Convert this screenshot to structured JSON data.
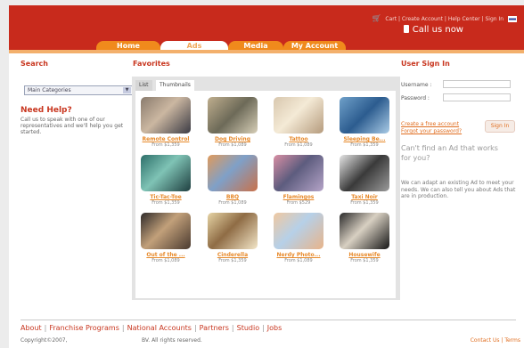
{
  "header": {
    "links": [
      "Cart",
      "Create Account",
      "Help Center",
      "Sign In"
    ],
    "call_us": "Call us now",
    "colors": {
      "header": "#c82a1c",
      "tab": "#f08a1c",
      "accent": "#e06d1f"
    }
  },
  "tabs": [
    {
      "label": "Home"
    },
    {
      "label": "Ads"
    },
    {
      "label": "Media"
    },
    {
      "label": "My Account"
    }
  ],
  "search": {
    "title": "Search",
    "select_value": "Main Categories",
    "help_title": "Need Help?",
    "help_text": "Call us to speak with one of our representatives and we'll help you get started."
  },
  "favorites": {
    "title": "Favorites",
    "view_tabs": [
      "List",
      "Thumbnails"
    ],
    "items": [
      {
        "title": "Remote Control",
        "price": "From $1,359",
        "icon": "businessman-photo"
      },
      {
        "title": "Dog Driving",
        "price": "From $1,089",
        "icon": "dog-photo"
      },
      {
        "title": "Tattoo",
        "price": "From $1,089",
        "icon": "tattoo-photo"
      },
      {
        "title": "Sleeping Be...",
        "price": "From $1,359",
        "icon": "sleeping-photo"
      },
      {
        "title": "Tic-Tac-Toe",
        "price": "From $1,359",
        "icon": "doctor-photo"
      },
      {
        "title": "BBQ",
        "price": "From $1,089",
        "icon": "bbq-photo"
      },
      {
        "title": "Flamingos",
        "price": "From $529",
        "icon": "flamingo-photo"
      },
      {
        "title": "Taxi Noir",
        "price": "From $1,359",
        "icon": "taxi-photo"
      },
      {
        "title": "Out of the ...",
        "price": "From $1,089",
        "icon": "party-photo"
      },
      {
        "title": "Cinderella",
        "price": "From $1,359",
        "icon": "bride-photo"
      },
      {
        "title": "Nerdy Photo...",
        "price": "From $1,089",
        "icon": "nerd-photo"
      },
      {
        "title": "Housewife",
        "price": "From $1,359",
        "icon": "housewife-photo"
      }
    ]
  },
  "signin": {
    "title": "User Sign In",
    "username_label": "Username :",
    "password_label": "Password :",
    "create_account": "Create a free account",
    "forgot_password": "Forgot your password?",
    "button": "Sign In",
    "cant_find": "Can't find an Ad that works for you?",
    "adapt_text": "We can adapt an existing Ad to meet your needs. We can also tell you about Ads that are in production."
  },
  "footer": {
    "nav": [
      "About",
      "Franchise Programs",
      "National Accounts",
      "Partners",
      "Studio",
      "Jobs"
    ],
    "copyright": "Copyright©2007,",
    "rights": "BV. All rights reserved.",
    "links": [
      "Contact Us",
      "Terms"
    ]
  }
}
